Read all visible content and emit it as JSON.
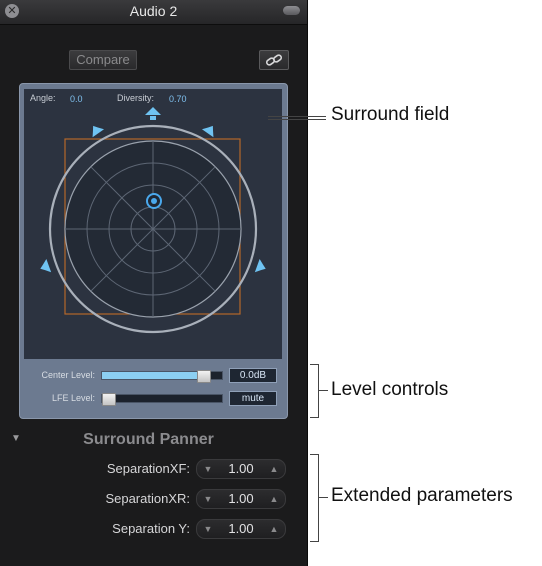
{
  "window": {
    "title": "Audio 2",
    "compare_label": "Compare"
  },
  "surround": {
    "angle_label": "Angle:",
    "angle_value": "0.0",
    "diversity_label": "Diversity:",
    "diversity_value": "0.70"
  },
  "levels": {
    "center_label": "Center Level:",
    "center_value": "0.0dB",
    "center_fill": 0.88,
    "lfe_label": "LFE Level:",
    "lfe_value": "mute",
    "lfe_fill": 0.0
  },
  "panner": {
    "title": "Surround Panner",
    "params": [
      {
        "label": "SeparationXF:",
        "value": "1.00"
      },
      {
        "label": "SeparationXR:",
        "value": "1.00"
      },
      {
        "label": "Separation Y:",
        "value": "1.00"
      }
    ]
  },
  "callouts": {
    "surround_field": "Surround field",
    "level_controls": "Level controls",
    "extended_parameters": "Extended parameters"
  },
  "icons": {
    "close": "close-icon",
    "zoom": "zoom-icon",
    "link": "link-icon",
    "disclosure": "disclosure-triangle-icon",
    "speaker": "speaker-icon",
    "stepper_down": "chevron-down-icon",
    "stepper_up": "chevron-up-icon"
  },
  "colors": {
    "window_bg": "#1b1b1c",
    "panel_bg": "#6c7a90",
    "field_bg": "#2c3340",
    "accent_blue": "#7fc0ee",
    "speaker_blue": "#6fc3f2",
    "frame_orange": "#b3672a"
  }
}
